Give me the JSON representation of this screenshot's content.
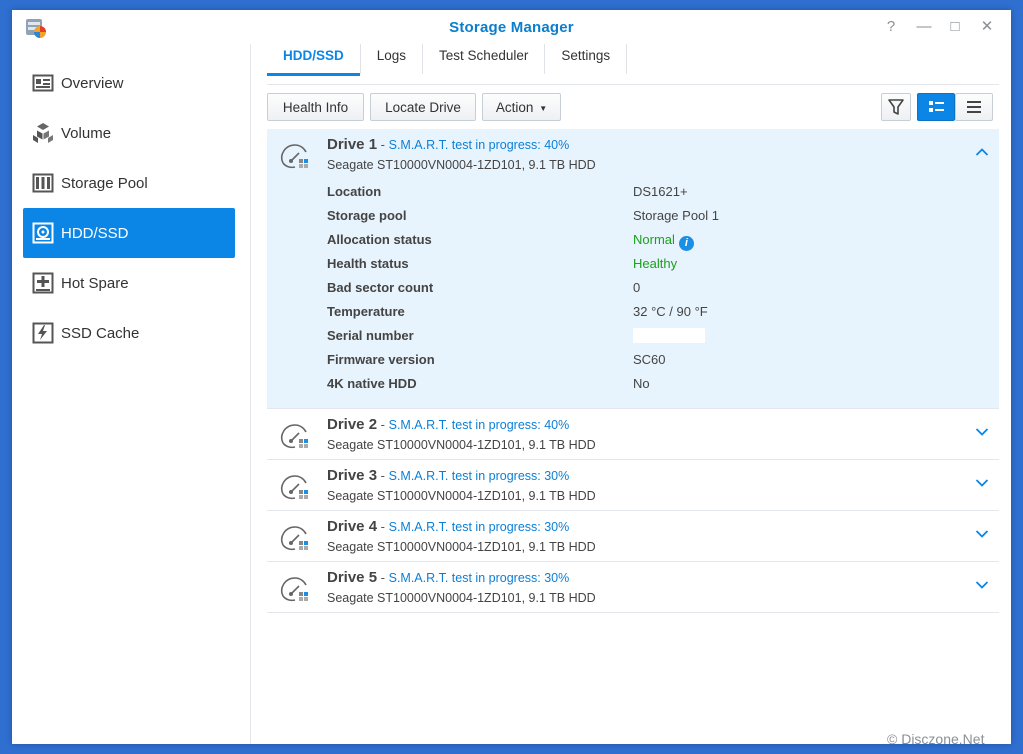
{
  "window": {
    "title": "Storage Manager",
    "controls": [
      "?",
      "—",
      "□",
      "✕"
    ]
  },
  "sidebar": {
    "items": [
      {
        "label": "Overview",
        "icon": "overview-icon"
      },
      {
        "label": "Volume",
        "icon": "volume-icon"
      },
      {
        "label": "Storage Pool",
        "icon": "storage-pool-icon"
      },
      {
        "label": "HDD/SSD",
        "icon": "hdd-icon",
        "active": true
      },
      {
        "label": "Hot Spare",
        "icon": "hot-spare-icon"
      },
      {
        "label": "SSD Cache",
        "icon": "ssd-cache-icon"
      }
    ]
  },
  "tabs": [
    "HDD/SSD",
    "Logs",
    "Test Scheduler",
    "Settings"
  ],
  "toolbar": {
    "health_info": "Health Info",
    "locate_drive": "Locate Drive",
    "action": "Action"
  },
  "drives": [
    {
      "name": "Drive 1",
      "sep": " - ",
      "status": "S.M.A.R.T. test in progress: 40%",
      "model": "Seagate ST10000VN0004-1ZD101, 9.1 TB HDD",
      "expanded": true,
      "details": [
        {
          "key": "Location",
          "value": "DS1621+"
        },
        {
          "key": "Storage pool",
          "value": "Storage Pool 1"
        },
        {
          "key": "Allocation status",
          "value": "Normal",
          "color": "green",
          "info": "i"
        },
        {
          "key": "Health status",
          "value": "Healthy",
          "color": "green"
        },
        {
          "key": "Bad sector count",
          "value": "0"
        },
        {
          "key": "Temperature",
          "value": "32 °C / 90 °F"
        },
        {
          "key": "Serial number",
          "value": ""
        },
        {
          "key": "Firmware version",
          "value": "SC60"
        },
        {
          "key": "4K native HDD",
          "value": "No"
        }
      ]
    },
    {
      "name": "Drive 2",
      "sep": " - ",
      "status": "S.M.A.R.T. test in progress: 40%",
      "model": "Seagate ST10000VN0004-1ZD101, 9.1 TB HDD"
    },
    {
      "name": "Drive 3",
      "sep": " - ",
      "status": "S.M.A.R.T. test in progress: 30%",
      "model": "Seagate ST10000VN0004-1ZD101, 9.1 TB HDD"
    },
    {
      "name": "Drive 4",
      "sep": " - ",
      "status": "S.M.A.R.T. test in progress: 30%",
      "model": "Seagate ST10000VN0004-1ZD101, 9.1 TB HDD"
    },
    {
      "name": "Drive 5",
      "sep": " - ",
      "status": "S.M.A.R.T. test in progress: 30%",
      "model": "Seagate ST10000VN0004-1ZD101, 9.1 TB HDD"
    }
  ],
  "watermark": "© Disczone.Net",
  "colors": {
    "accent": "#0b86e6",
    "healthy": "#1aa01a",
    "background": "#2f6fd0"
  }
}
